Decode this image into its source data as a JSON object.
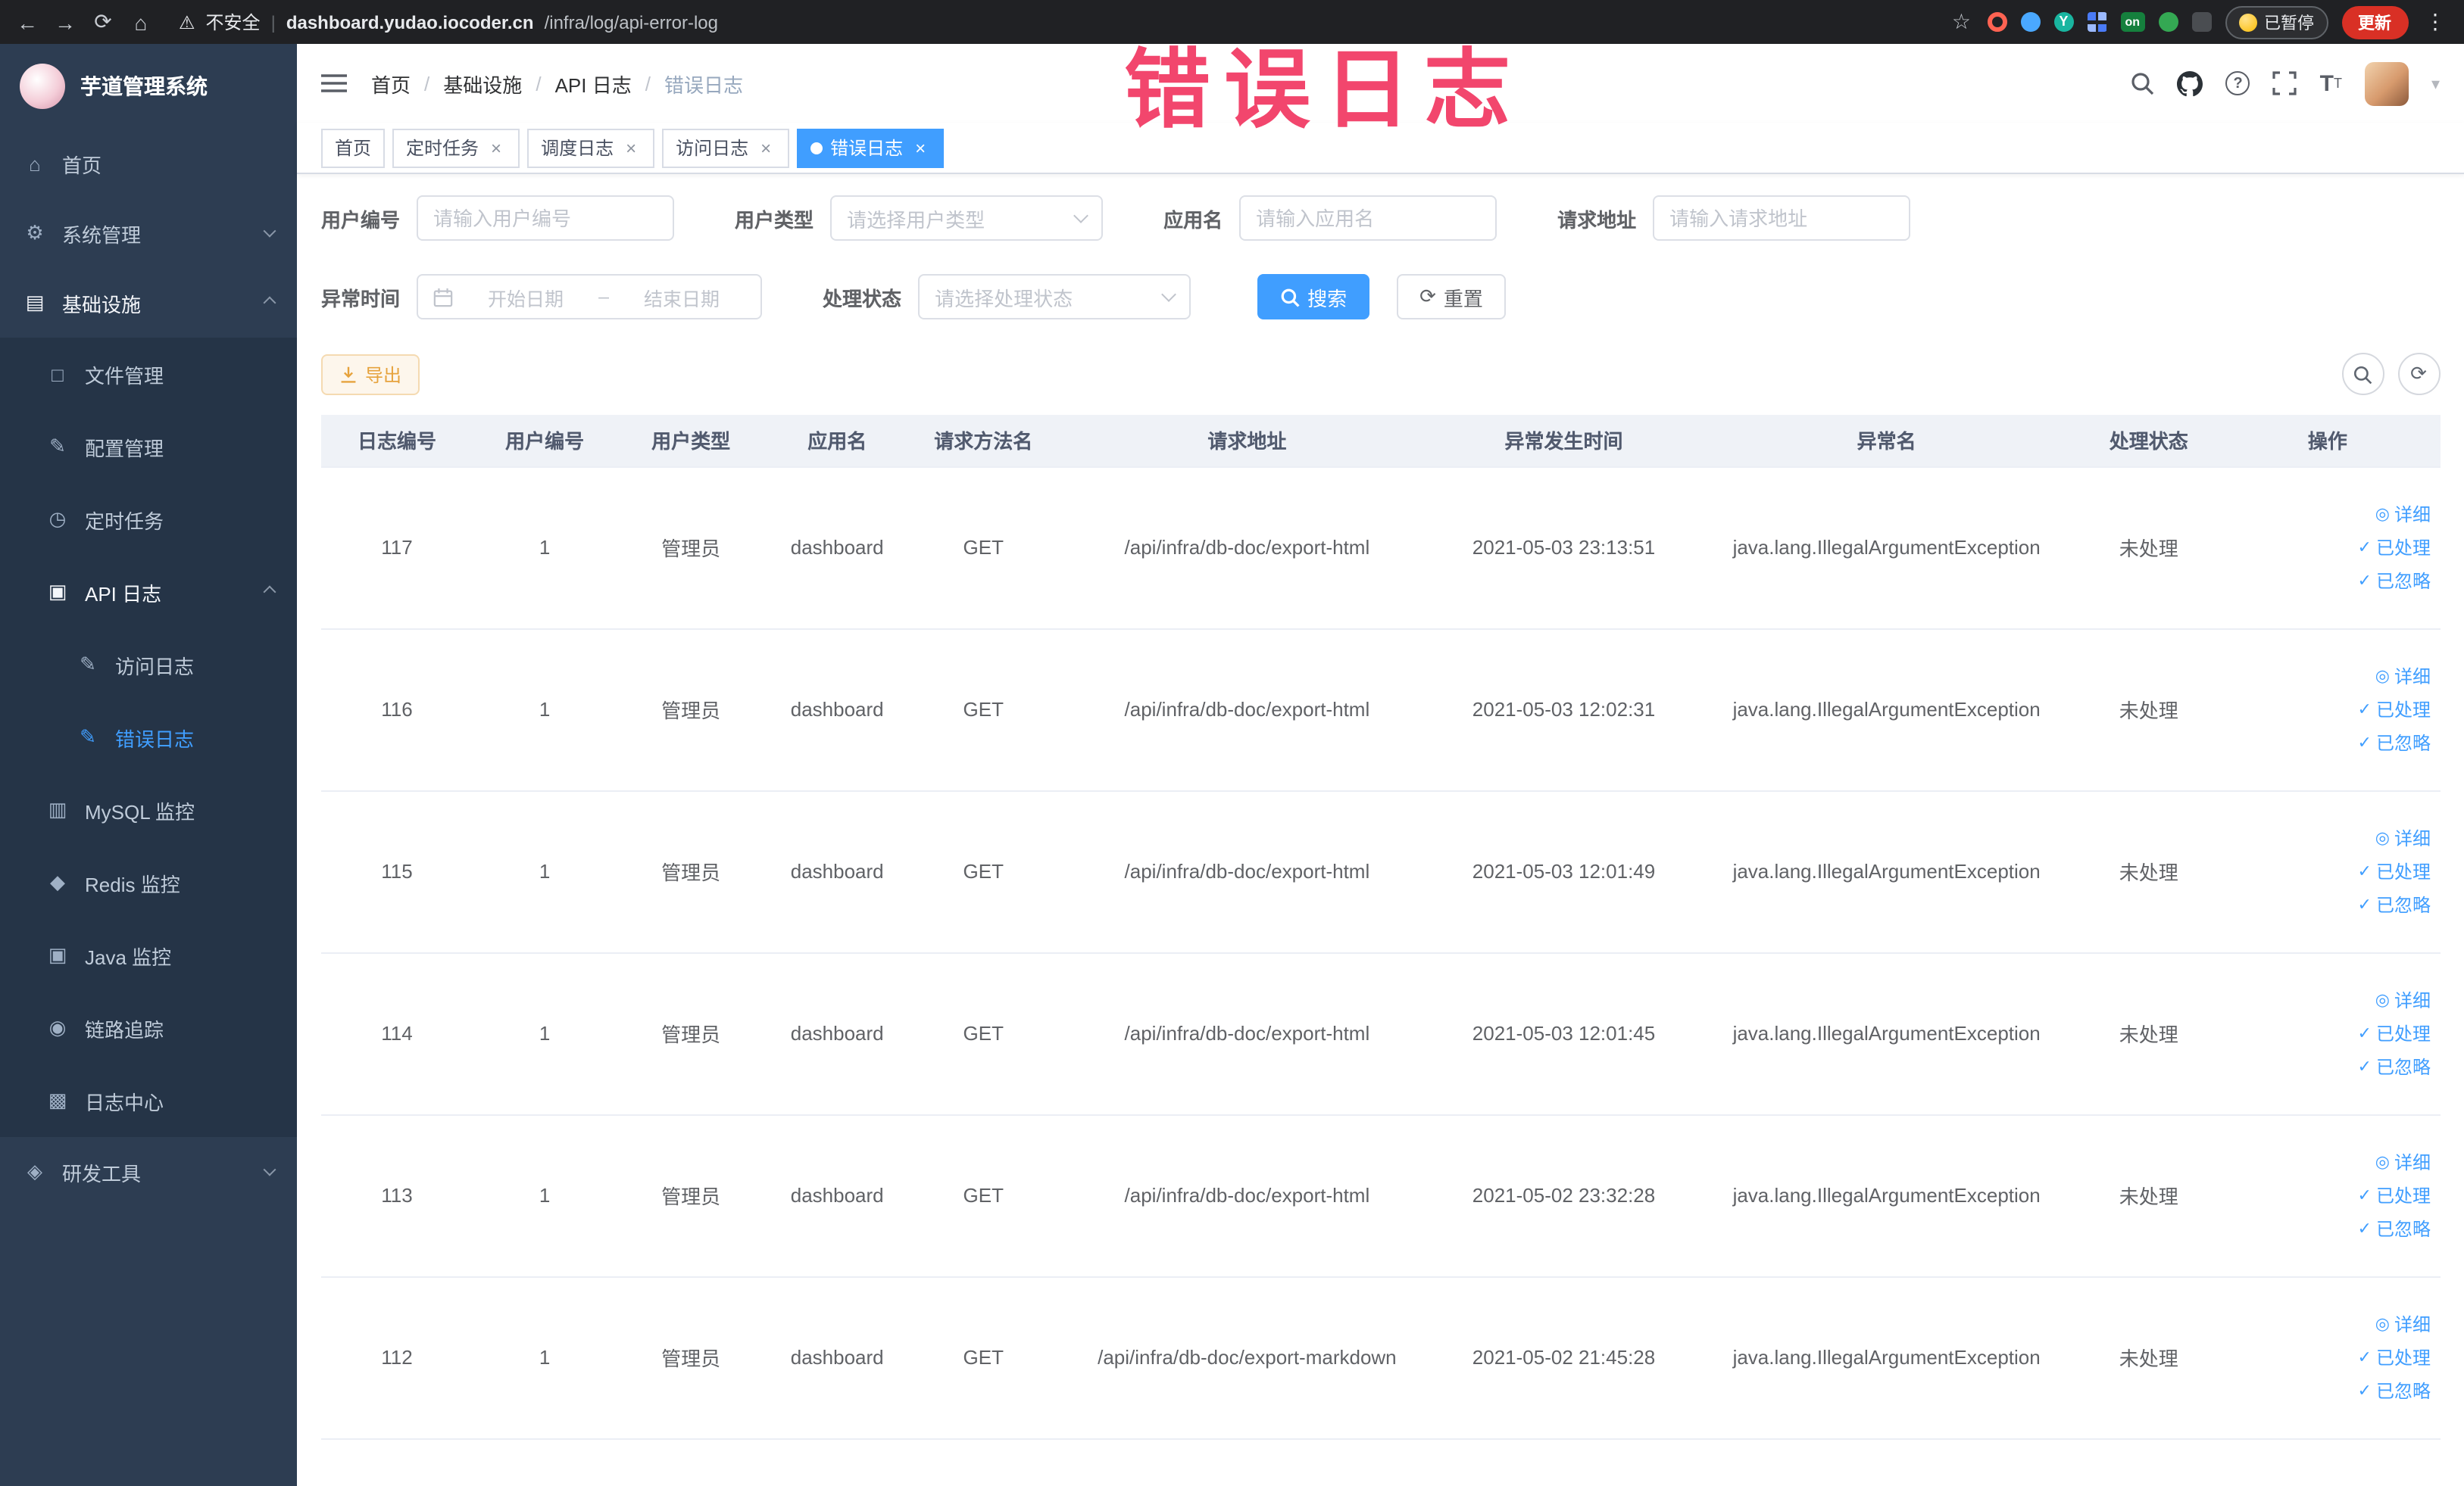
{
  "glyphs": {
    "back": "←",
    "forward": "→",
    "reload": "⟳",
    "home": "⌂",
    "warning": "⚠",
    "star": "☆",
    "more": "⋮",
    "close": "×",
    "caret": "▾",
    "question": "?",
    "font": "T",
    "check": "✓",
    "view": "◎",
    "dash": "–",
    "ext_y": "Y",
    "menu_home": "⌂",
    "menu_system": "⚙",
    "menu_infra": "▤",
    "menu_file": "□",
    "menu_config": "✎",
    "menu_task": "◷",
    "menu_apilog": "▣",
    "menu_doc": "✎",
    "menu_mysql": "▥",
    "menu_redis": "◆",
    "menu_java": "▣",
    "menu_trace": "◉",
    "menu_logcenter": "▩",
    "menu_devtools": "◈"
  },
  "browser": {
    "security": "不安全",
    "url_domain": "dashboard.yudao.iocoder.cn",
    "url_path": "/infra/log/api-error-log",
    "paused_badge": "已暂停",
    "update_button": "更新",
    "ext_badge": "on"
  },
  "annotation": {
    "text": "错误日志"
  },
  "sidebar": {
    "title": "芋道管理系统",
    "items": [
      {
        "label": "首页"
      },
      {
        "label": "系统管理"
      },
      {
        "label": "基础设施",
        "children": [
          {
            "label": "文件管理"
          },
          {
            "label": "配置管理"
          },
          {
            "label": "定时任务"
          },
          {
            "label": "API 日志",
            "children": [
              {
                "label": "访问日志"
              },
              {
                "label": "错误日志"
              }
            ]
          },
          {
            "label": "MySQL 监控"
          },
          {
            "label": "Redis 监控"
          },
          {
            "label": "Java 监控"
          },
          {
            "label": "链路追踪"
          },
          {
            "label": "日志中心"
          }
        ]
      },
      {
        "label": "研发工具"
      }
    ]
  },
  "header": {
    "separator": "/",
    "breadcrumb": [
      "首页",
      "基础设施",
      "API 日志",
      "错误日志"
    ]
  },
  "tabs": {
    "labels": [
      "首页",
      "定时任务",
      "调度日志",
      "访问日志",
      "错误日志"
    ]
  },
  "filters": {
    "user_id": {
      "label": "用户编号",
      "placeholder": "请输入用户编号"
    },
    "user_type": {
      "label": "用户类型",
      "placeholder": "请选择用户类型"
    },
    "app_name": {
      "label": "应用名",
      "placeholder": "请输入应用名"
    },
    "request_url": {
      "label": "请求地址",
      "placeholder": "请输入请求地址"
    },
    "exception_time": {
      "label": "异常时间",
      "start_placeholder": "开始日期",
      "end_placeholder": "结束日期"
    },
    "process_status": {
      "label": "处理状态",
      "placeholder": "请选择处理状态"
    },
    "search_button": "搜索",
    "reset_button": "重置"
  },
  "toolbar": {
    "export_button": "导出"
  },
  "table": {
    "columns": [
      "日志编号",
      "用户编号",
      "用户类型",
      "应用名",
      "请求方法名",
      "请求地址",
      "异常发生时间",
      "异常名",
      "处理状态",
      "操作"
    ],
    "actions": [
      "详细",
      "已处理",
      "已忽略"
    ],
    "rows": [
      {
        "id": "117",
        "user_id": "1",
        "user_type": "管理员",
        "app": "dashboard",
        "method": "GET",
        "url": "/api/infra/db-doc/export-html",
        "time": "2021-05-03 23:13:51",
        "exception": "java.lang.IllegalArgumentException",
        "status": "未处理"
      },
      {
        "id": "116",
        "user_id": "1",
        "user_type": "管理员",
        "app": "dashboard",
        "method": "GET",
        "url": "/api/infra/db-doc/export-html",
        "time": "2021-05-03 12:02:31",
        "exception": "java.lang.IllegalArgumentException",
        "status": "未处理"
      },
      {
        "id": "115",
        "user_id": "1",
        "user_type": "管理员",
        "app": "dashboard",
        "method": "GET",
        "url": "/api/infra/db-doc/export-html",
        "time": "2021-05-03 12:01:49",
        "exception": "java.lang.IllegalArgumentException",
        "status": "未处理"
      },
      {
        "id": "114",
        "user_id": "1",
        "user_type": "管理员",
        "app": "dashboard",
        "method": "GET",
        "url": "/api/infra/db-doc/export-html",
        "time": "2021-05-03 12:01:45",
        "exception": "java.lang.IllegalArgumentException",
        "status": "未处理"
      },
      {
        "id": "113",
        "user_id": "1",
        "user_type": "管理员",
        "app": "dashboard",
        "method": "GET",
        "url": "/api/infra/db-doc/export-html",
        "time": "2021-05-02 23:32:28",
        "exception": "java.lang.IllegalArgumentException",
        "status": "未处理"
      },
      {
        "id": "112",
        "user_id": "1",
        "user_type": "管理员",
        "app": "dashboard",
        "method": "GET",
        "url": "/api/infra/db-doc/export-markdown",
        "time": "2021-05-02 21:45:28",
        "exception": "java.lang.IllegalArgumentException",
        "status": "未处理"
      }
    ]
  }
}
